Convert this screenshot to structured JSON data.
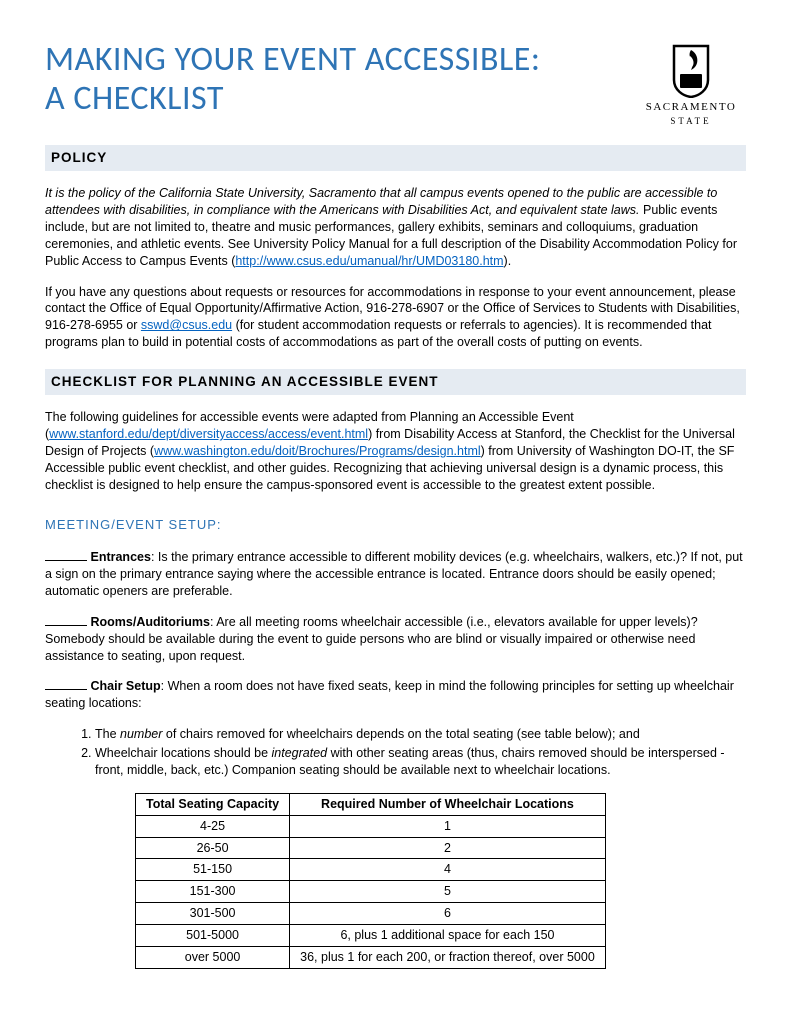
{
  "title_line1": "MAKING YOUR EVENT ACCESSIBLE:",
  "title_line2": "A CHECKLIST",
  "logo": {
    "name": "SACRAMENTO",
    "sub": "STATE"
  },
  "policy_heading": "POLICY",
  "policy_para1_italic": "It is the policy of the California State University, Sacramento that all campus events opened to the public are accessible to attendees with disabilities, in compliance with the Americans with Disabilities Act, and equivalent state laws.",
  "policy_para1_rest": " Public events include, but are not limited to, theatre and music performances, gallery exhibits, seminars and colloquiums, graduation ceremonies, and athletic events. See University Policy Manual for a full description of the Disability Accommodation Policy for Public Access to Campus Events (",
  "policy_link1": "http://www.csus.edu/umanual/hr/UMD03180.htm",
  "policy_para1_close": ").",
  "policy_para2_a": "If you have any questions about requests or resources for accommodations in response to your event announcement, please contact the Office of Equal Opportunity/Affirmative Action, 916-278-6907 or the Office of Services to Students with Disabilities, 916-278-6955 or ",
  "policy_link2": "sswd@csus.edu",
  "policy_para2_b": " (for student accommodation requests or referrals to agencies). It is recommended that programs plan to build in potential costs of accommodations as part of the overall costs of putting on events.",
  "checklist_heading": "CHECKLIST FOR PLANNING AN ACCESSIBLE EVENT",
  "checklist_intro_a": "The following guidelines for accessible events were adapted from Planning an Accessible Event (",
  "checklist_link1": "www.stanford.edu/dept/diversityaccess/access/event.html",
  "checklist_intro_b": ") from Disability Access at Stanford, the Checklist for the Universal Design of Projects (",
  "checklist_link2": "www.washington.edu/doit/Brochures/Programs/design.html",
  "checklist_intro_c": ") from University of Washington DO-IT, the SF Accessible public event checklist, and other guides. Recognizing that achieving universal design is a dynamic process, this checklist is designed to help ensure the campus-sponsored event is accessible to the greatest extent possible.",
  "setup_heading": "MEETING/EVENT SETUP:",
  "item1_label": "Entrances",
  "item1_text": ": Is the primary entrance accessible to different mobility devices (e.g. wheelchairs, walkers, etc.)? If not, put a sign on the primary entrance saying where the accessible entrance is located. Entrance doors should be easily opened; automatic openers are preferable.",
  "item2_label": "Rooms/Auditoriums",
  "item2_text": ": Are all meeting rooms wheelchair accessible (i.e., elevators available for upper levels)? Somebody should be available during the event to guide persons who are blind or visually impaired or otherwise need assistance to seating, upon request.",
  "item3_label": "Chair Setup",
  "item3_text": ": When a room does not have fixed seats, keep in mind the following principles for setting up wheelchair seating locations:",
  "ol1_a": "The ",
  "ol1_em": "number",
  "ol1_b": " of chairs removed for wheelchairs depends on the total seating (see table below); and",
  "ol2_a": "Wheelchair locations should be ",
  "ol2_em": "integrated",
  "ol2_b": " with other seating areas (thus, chairs removed should be interspersed - front, middle, back, etc.) Companion seating should be available next to wheelchair locations.",
  "table": {
    "h1": "Total Seating Capacity",
    "h2": "Required Number of Wheelchair Locations",
    "rows": [
      {
        "c": "4-25",
        "r": "1"
      },
      {
        "c": "26-50",
        "r": "2"
      },
      {
        "c": "51-150",
        "r": "4"
      },
      {
        "c": "151-300",
        "r": "5"
      },
      {
        "c": "301-500",
        "r": "6"
      },
      {
        "c": "501-5000",
        "r": "6, plus 1 additional space for each 150"
      },
      {
        "c": "over 5000",
        "r": "36, plus 1 for each 200, or fraction thereof, over 5000"
      }
    ]
  }
}
